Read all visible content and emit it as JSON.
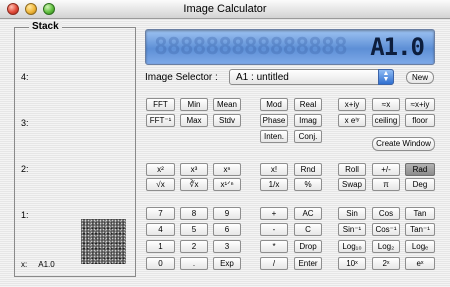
{
  "window": {
    "title": "Image Calculator"
  },
  "stack": {
    "title": "Stack",
    "levels": [
      "4:",
      "3:",
      "2:",
      "1:"
    ],
    "x_label": "x:",
    "x_value": "A1.0"
  },
  "display": {
    "ghost": "888888888888888",
    "value": "A1.0"
  },
  "selector": {
    "label": "Image Selector :",
    "value": "A1 : untitled",
    "new_label": "New"
  },
  "buttons": {
    "fft": "FFT",
    "ifft": "FFT⁻¹",
    "min": "Min",
    "max": "Max",
    "mean": "Mean",
    "stdv": "Stdv",
    "mod": "Mod",
    "real": "Real",
    "phase": "Phase",
    "imag": "Imag",
    "inten": "Inten.",
    "conj": "Conj.",
    "xiy": "x+iy",
    "xeiy": "x eⁱʸ",
    "eqx": "≈x",
    "eqxiy": "≈x+iy",
    "ceiling": "ceiling",
    "floor": "floor",
    "create_window": "Create Window",
    "x2": "x²",
    "x3": "x³",
    "xn": "xⁿ",
    "sqrt": "√x",
    "cbrt": "∛x",
    "xroot": "x¹ᐟⁿ",
    "fact": "x!",
    "rnd": "Rnd",
    "inv": "1/x",
    "pct": "%",
    "roll": "Roll",
    "plusminus": "+/-",
    "rad": "Rad",
    "swap": "Swap",
    "pi": "π",
    "deg": "Deg",
    "d7": "7",
    "d8": "8",
    "d9": "9",
    "d4": "4",
    "d5": "5",
    "d6": "6",
    "d1": "1",
    "d2": "2",
    "d3": "3",
    "d0": "0",
    "dot": ".",
    "exp": "Exp",
    "plus": "+",
    "ac": "AC",
    "minus": "-",
    "c": "C",
    "times": "*",
    "drop": "Drop",
    "div": "/",
    "enter": "Enter",
    "sin": "Sin",
    "cos": "Cos",
    "tan": "Tan",
    "asin": "Sin⁻¹",
    "acos": "Cos⁻¹",
    "atan": "Tan⁻¹",
    "log10": "Log₁₀",
    "log2": "Log₂",
    "loge": "Logₑ",
    "ten_x": "10ˣ",
    "two_x": "2ˣ",
    "e_x": "eˣ"
  }
}
